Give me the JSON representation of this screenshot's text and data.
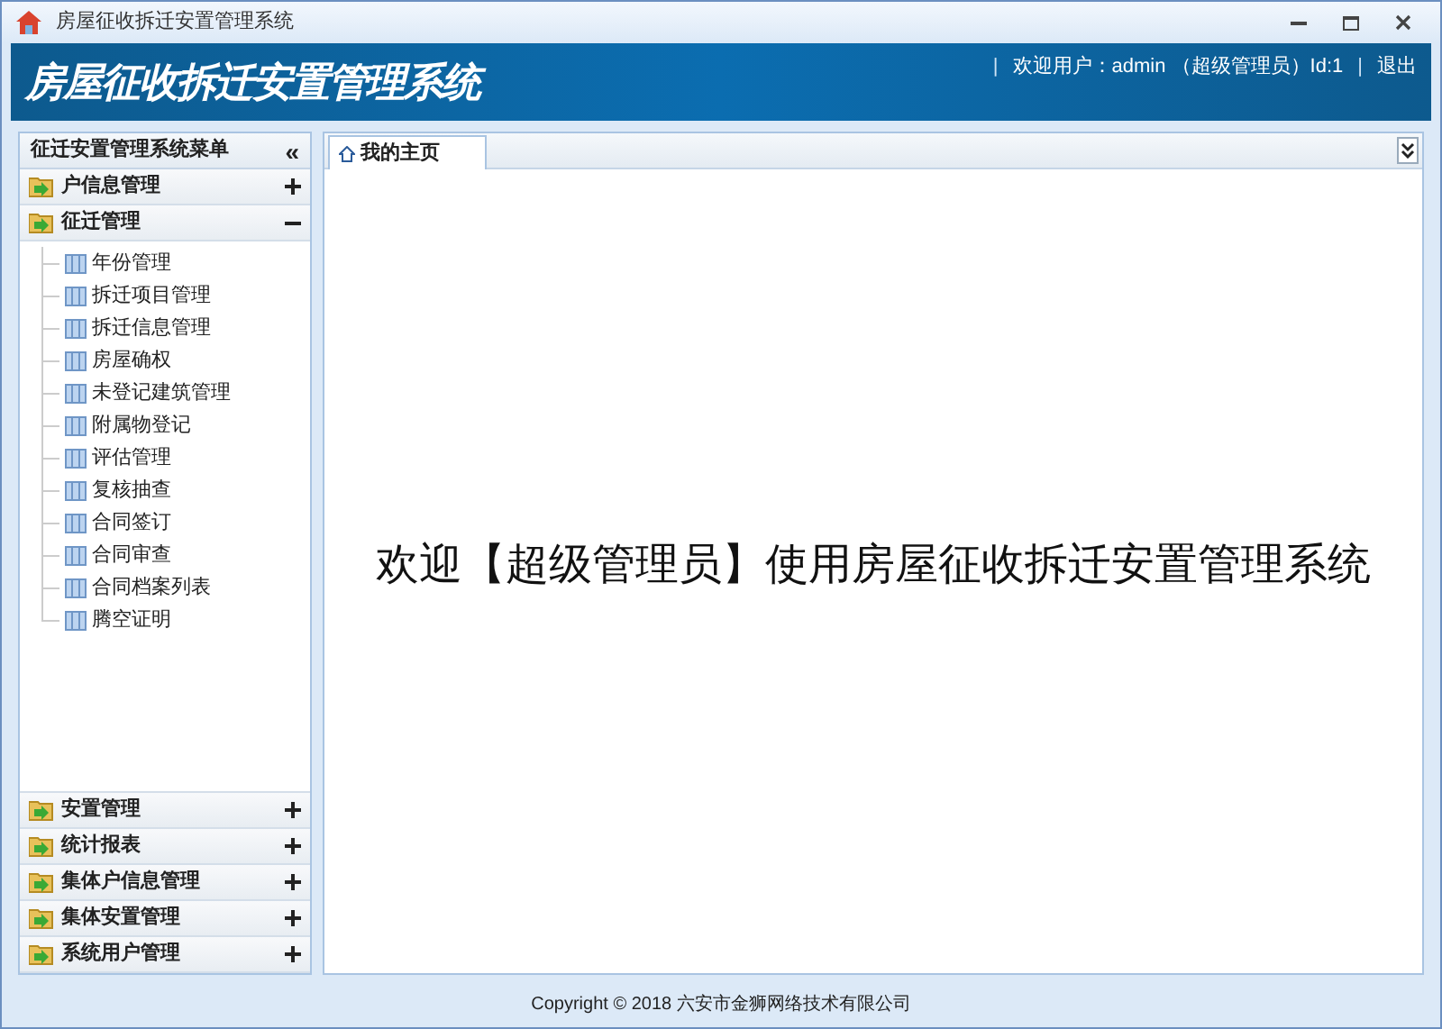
{
  "window": {
    "title": "房屋征收拆迁安置管理系统"
  },
  "header": {
    "title": "房屋征收拆迁安置管理系统",
    "separators": [
      "|",
      "|"
    ],
    "user_info": "欢迎用户：admin （超级管理员）Id:1",
    "logout": "退出"
  },
  "sidebar": {
    "title": "征迁安置管理系统菜单",
    "collapse": "«",
    "groups": [
      {
        "label": "户信息管理",
        "expanded": false
      },
      {
        "label": "征迁管理",
        "expanded": true,
        "children": [
          {
            "label": "年份管理"
          },
          {
            "label": "拆迁项目管理"
          },
          {
            "label": "拆迁信息管理"
          },
          {
            "label": "房屋确权"
          },
          {
            "label": "未登记建筑管理"
          },
          {
            "label": "附属物登记"
          },
          {
            "label": "评估管理"
          },
          {
            "label": "复核抽查"
          },
          {
            "label": "合同签订"
          },
          {
            "label": "合同审查"
          },
          {
            "label": "合同档案列表"
          },
          {
            "label": "腾空证明"
          }
        ]
      },
      {
        "label": "安置管理",
        "expanded": false
      },
      {
        "label": "统计报表",
        "expanded": false
      },
      {
        "label": "集体户信息管理",
        "expanded": false
      },
      {
        "label": "集体安置管理",
        "expanded": false
      },
      {
        "label": "系统用户管理",
        "expanded": false
      }
    ]
  },
  "tabs": [
    {
      "label": "我的主页",
      "selected": true
    }
  ],
  "welcome": "欢迎【超级管理员】使用房屋征收拆迁安置管理系统",
  "footer": "Copyright © 2018 六安市金狮网络技术有限公司"
}
